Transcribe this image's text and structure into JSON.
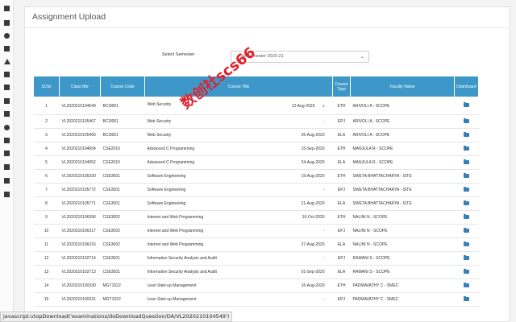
{
  "page": {
    "title": "Assignment Upload"
  },
  "semester": {
    "label": "Select Semester",
    "selected": "Fall Semester 2020-21"
  },
  "table": {
    "headers": [
      "Sl.No",
      "Class Nbr",
      "Course Code",
      "Course Title",
      "Course Type",
      "Faculty Name",
      "Dashboard"
    ],
    "rows": [
      {
        "sl": "1",
        "nbr": "VL2020210104549",
        "code": "BCI3001",
        "title": "Web Security",
        "date": "12-Aug-2020",
        "type": "ETH",
        "faculty": "ARIVOLI A - SCOPE",
        "download": true
      },
      {
        "sl": "2",
        "nbr": "VL2020210105467",
        "code": "BCI3001",
        "title": "Web Security",
        "date": "-",
        "type": "EPJ",
        "faculty": "ARIVOLI A - SCOPE"
      },
      {
        "sl": "3",
        "nbr": "VL2020210105466",
        "code": "BCI3001",
        "title": "Web Security",
        "date": "26-Aug-2020",
        "type": "ELA",
        "faculty": "ARIVOLI A - SCOPE"
      },
      {
        "sl": "4",
        "nbr": "VL2020210104654",
        "code": "CSE2010",
        "title": "Advanced C Programming",
        "date": "15-Sep-2020",
        "type": "ETH",
        "faculty": "MANJULA R - SCOPE"
      },
      {
        "sl": "5",
        "nbr": "VL2020210104952",
        "code": "CSE2010",
        "title": "Advanced C Programming",
        "date": "24-Aug-2020",
        "type": "ELA",
        "faculty": "MANJULA R - SCOPE"
      },
      {
        "sl": "6",
        "nbr": "VL2020210105330",
        "code": "CSE3001",
        "title": "Software Engineering",
        "date": "19-Aug-2020",
        "type": "ETH",
        "faculty": "SWETA BHATTACHARYA - SITE"
      },
      {
        "sl": "7",
        "nbr": "VL2020210105772",
        "code": "CSE3001",
        "title": "Software Engineering",
        "date": "-",
        "type": "EPJ",
        "faculty": "SWETA BHATTACHARYA - SITE"
      },
      {
        "sl": "8",
        "nbr": "VL2020210105771",
        "code": "CSE3001",
        "title": "Software Engineering",
        "date": "21-Aug-2020",
        "type": "ELA",
        "faculty": "SWETA BHATTACHARYA - SITE"
      },
      {
        "sl": "9",
        "nbr": "VL2020210106396",
        "code": "CSE3002",
        "title": "Internet and Web Programming",
        "date": "10-Oct-2020",
        "type": "ETH",
        "faculty": "NALINI N - SCOPE"
      },
      {
        "sl": "10",
        "nbr": "VL2020210106317",
        "code": "CSE3002",
        "title": "Internet and Web Programming",
        "date": "-",
        "type": "EPJ",
        "faculty": "NALINI N - SCOPE"
      },
      {
        "sl": "11",
        "nbr": "VL2020210106316",
        "code": "CSE3002",
        "title": "Internet and Web Programming",
        "date": "27-Aug-2020",
        "type": "ELA",
        "faculty": "NALINI N - SCOPE"
      },
      {
        "sl": "12",
        "nbr": "VL2020210102714",
        "code": "CSE3501",
        "title": "Information Security Analysis and Audit",
        "date": "-",
        "type": "EPJ",
        "faculty": "RAMANI S - SCOPE"
      },
      {
        "sl": "13",
        "nbr": "VL2020210102713",
        "code": "CSE3501",
        "title": "Information Security Analysis and Audit",
        "date": "01-Sep-2020",
        "type": "ELA",
        "faculty": "RAMANI S - SCOPE"
      },
      {
        "sl": "14",
        "nbr": "VL2020210100330",
        "code": "MGT1022",
        "title": "Lean Start-up Management",
        "date": "16-Aug-2020",
        "type": "ETH",
        "faculty": "PADMAVATHY C - SMEC"
      },
      {
        "sl": "15",
        "nbr": "VL2020210100331",
        "code": "MGT1022",
        "title": "Lean Start-up Management",
        "date": "-",
        "type": "EPJ",
        "faculty": "PADMAVATHY C - SMEC"
      }
    ]
  },
  "watermark": "数创社scs66",
  "statusbar": "javascript:vtopDownload('examinations/doDownloadQuestion/DA/VL2020210104549')"
}
